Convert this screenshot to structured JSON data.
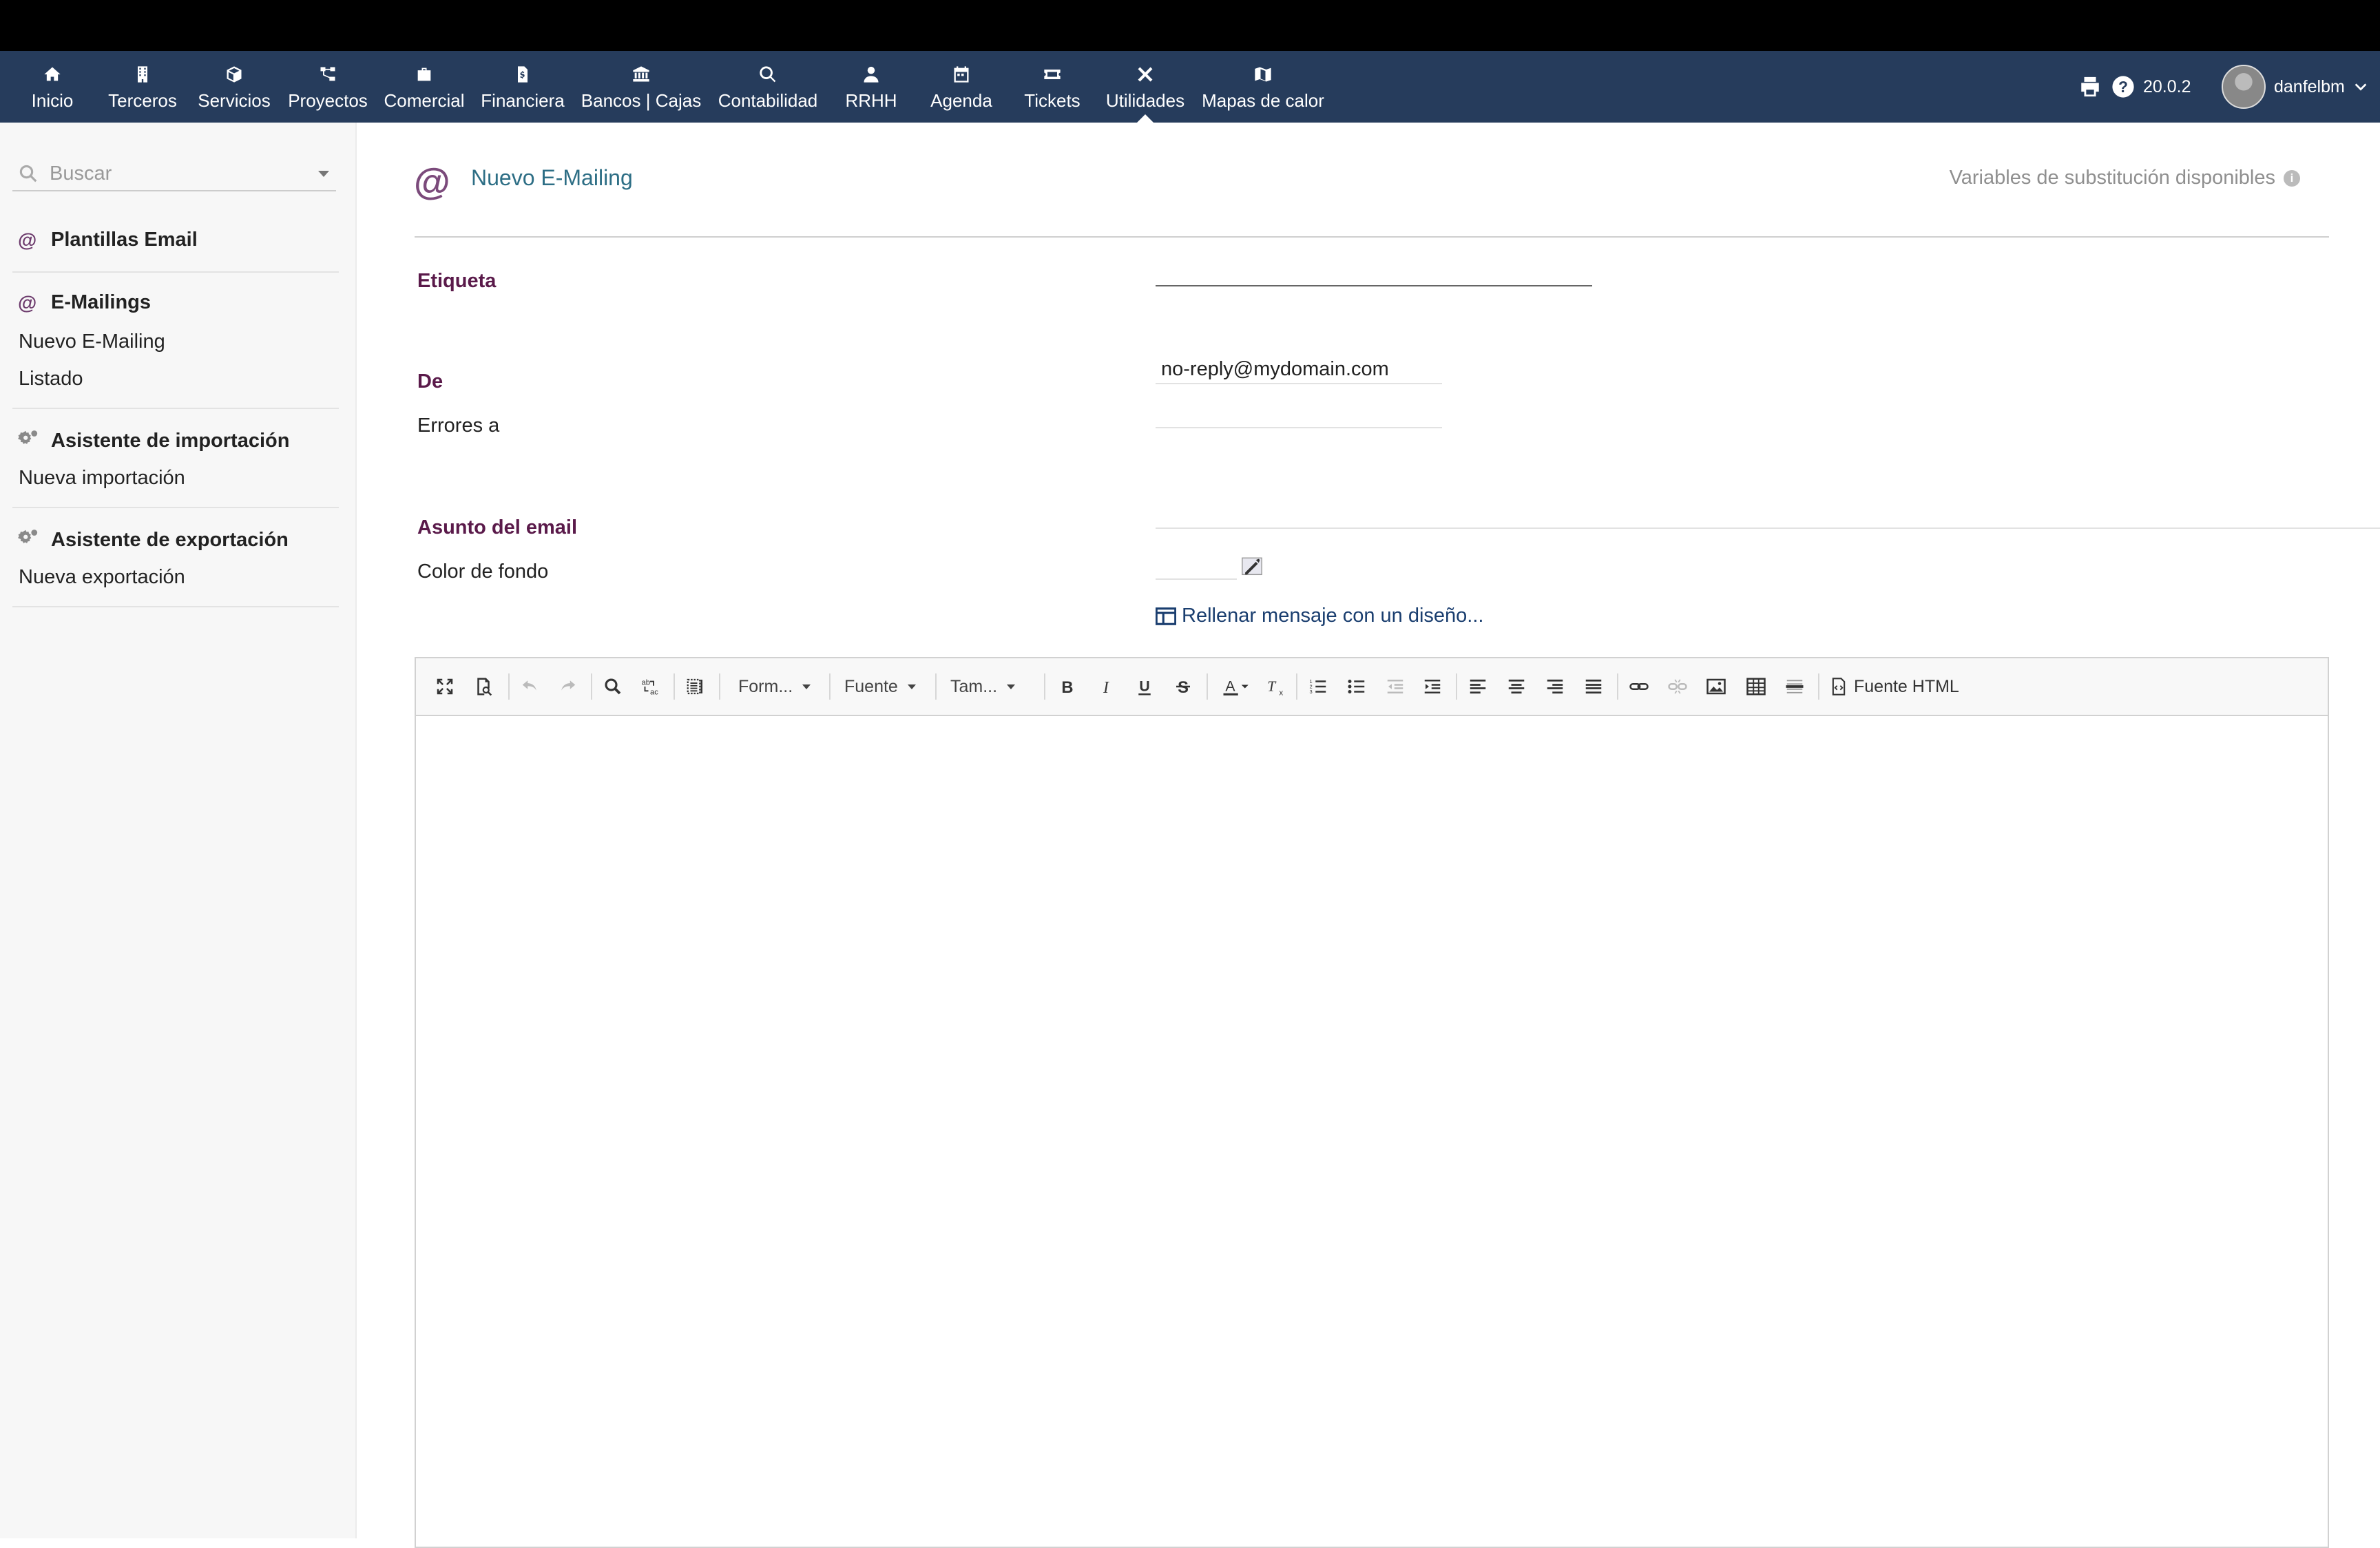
{
  "nav": {
    "items": [
      {
        "label": "Inicio",
        "icon": "home-icon"
      },
      {
        "label": "Terceros",
        "icon": "building-icon"
      },
      {
        "label": "Servicios",
        "icon": "cube-icon"
      },
      {
        "label": "Proyectos",
        "icon": "sitemap-icon"
      },
      {
        "label": "Comercial",
        "icon": "suitcase-icon"
      },
      {
        "label": "Financiera",
        "icon": "invoice-icon"
      },
      {
        "label": "Bancos | Cajas",
        "icon": "bank-icon"
      },
      {
        "label": "Contabilidad",
        "icon": "search-dollar-icon"
      },
      {
        "label": "RRHH",
        "icon": "user-tie-icon"
      },
      {
        "label": "Agenda",
        "icon": "calendar-icon"
      },
      {
        "label": "Tickets",
        "icon": "ticket-icon"
      },
      {
        "label": "Utilidades",
        "icon": "tools-icon",
        "active": true
      },
      {
        "label": "Mapas de calor",
        "icon": "map-icon"
      }
    ],
    "version": "20.0.2",
    "username": "danfelbm"
  },
  "sidebar": {
    "search_placeholder": "Buscar",
    "sections": [
      {
        "title": "Plantillas Email",
        "icon": "at-icon",
        "links": []
      },
      {
        "title": "E-Mailings",
        "icon": "at-icon",
        "links": [
          "Nuevo E-Mailing",
          "Listado"
        ]
      },
      {
        "title": "Asistente de importación",
        "icon": "cogs-icon",
        "links": [
          "Nueva importación"
        ]
      },
      {
        "title": "Asistente de exportación",
        "icon": "cogs-icon",
        "links": [
          "Nueva exportación"
        ]
      }
    ]
  },
  "page": {
    "title": "Nuevo E-Mailing",
    "at_symbol": "@",
    "vars_link": "Variables de substitución disponibles",
    "info_icon_text": "i"
  },
  "form": {
    "etiqueta_label": "Etiqueta",
    "etiqueta_value": "",
    "de_label": "De",
    "de_value": "no-reply@mydomain.com",
    "errores_label": "Errores a",
    "errores_value": "",
    "asunto_label": "Asunto del email",
    "asunto_value": "",
    "color_label": "Color de fondo",
    "design_link": "Rellenar mensaje con un diseño..."
  },
  "editor": {
    "format_label": "Form...",
    "font_label": "Fuente",
    "size_label": "Tam...",
    "source_label": "Fuente HTML",
    "content": ""
  },
  "colors": {
    "navbar": "#263c5c",
    "required_label": "#5a1a4a",
    "title": "#2d6e85"
  }
}
